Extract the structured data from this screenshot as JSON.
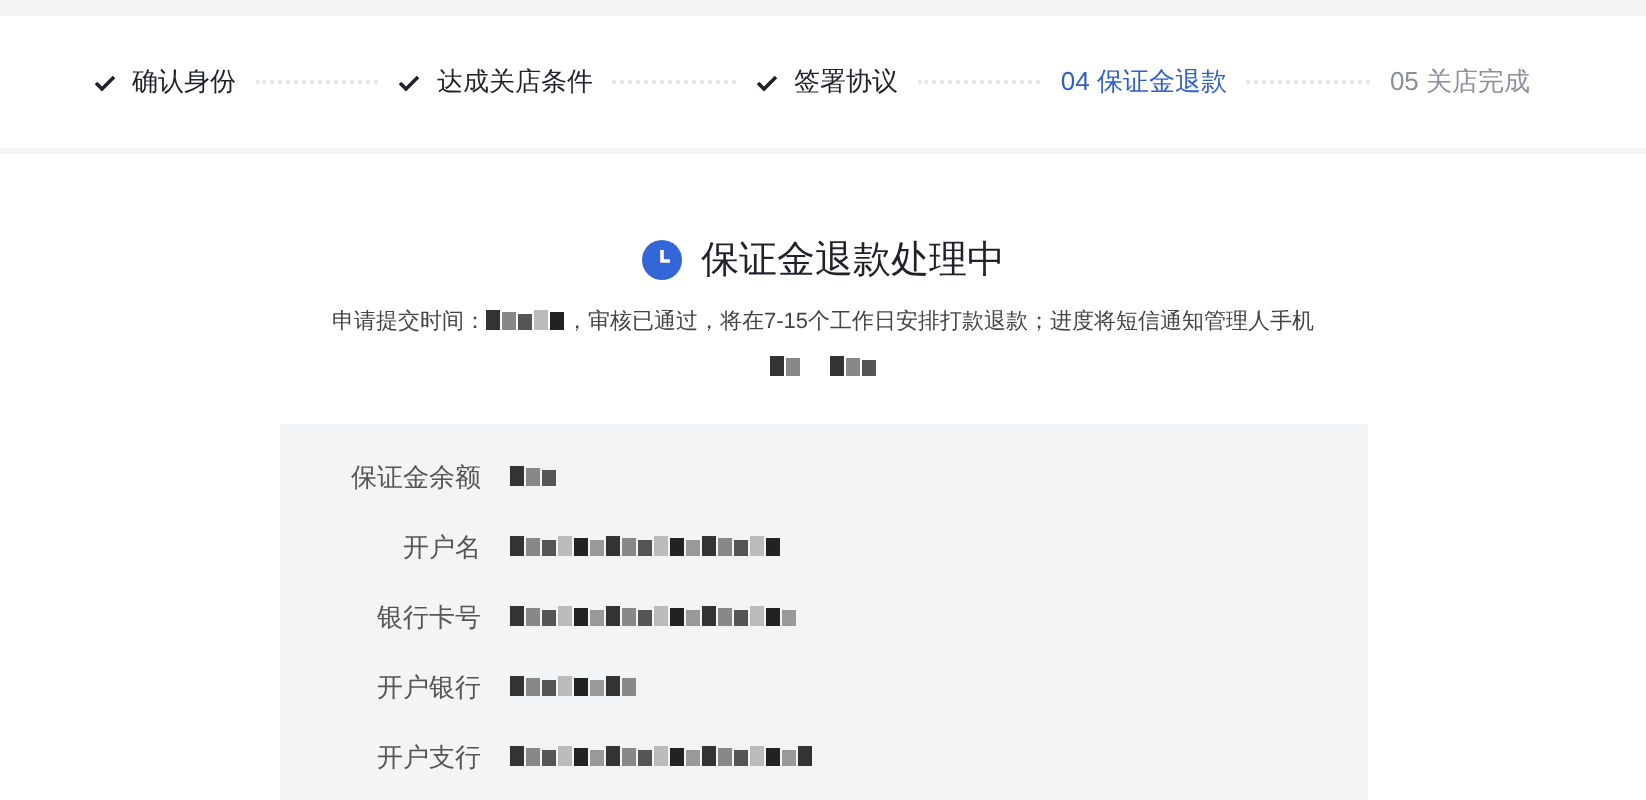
{
  "steps": [
    {
      "label": "确认身份",
      "completed": true,
      "selected": false
    },
    {
      "label": "达成关店条件",
      "completed": true,
      "selected": false
    },
    {
      "label": "签署协议",
      "completed": true,
      "selected": false
    },
    {
      "label": "04 保证金退款",
      "completed": false,
      "selected": true
    },
    {
      "label": "05 关店完成",
      "completed": false,
      "selected": false
    }
  ],
  "result": {
    "title": "保证金退款处理中",
    "notice_before": "申请提交时间：",
    "notice_after": "，审核已通过，将在7-15个工作日安排打款退款；进度将短信通知管理人手机"
  },
  "details": [
    {
      "label": "保证金余额"
    },
    {
      "label": "开户名"
    },
    {
      "label": "银行卡号"
    },
    {
      "label": "开户银行"
    },
    {
      "label": "开户支行"
    }
  ]
}
